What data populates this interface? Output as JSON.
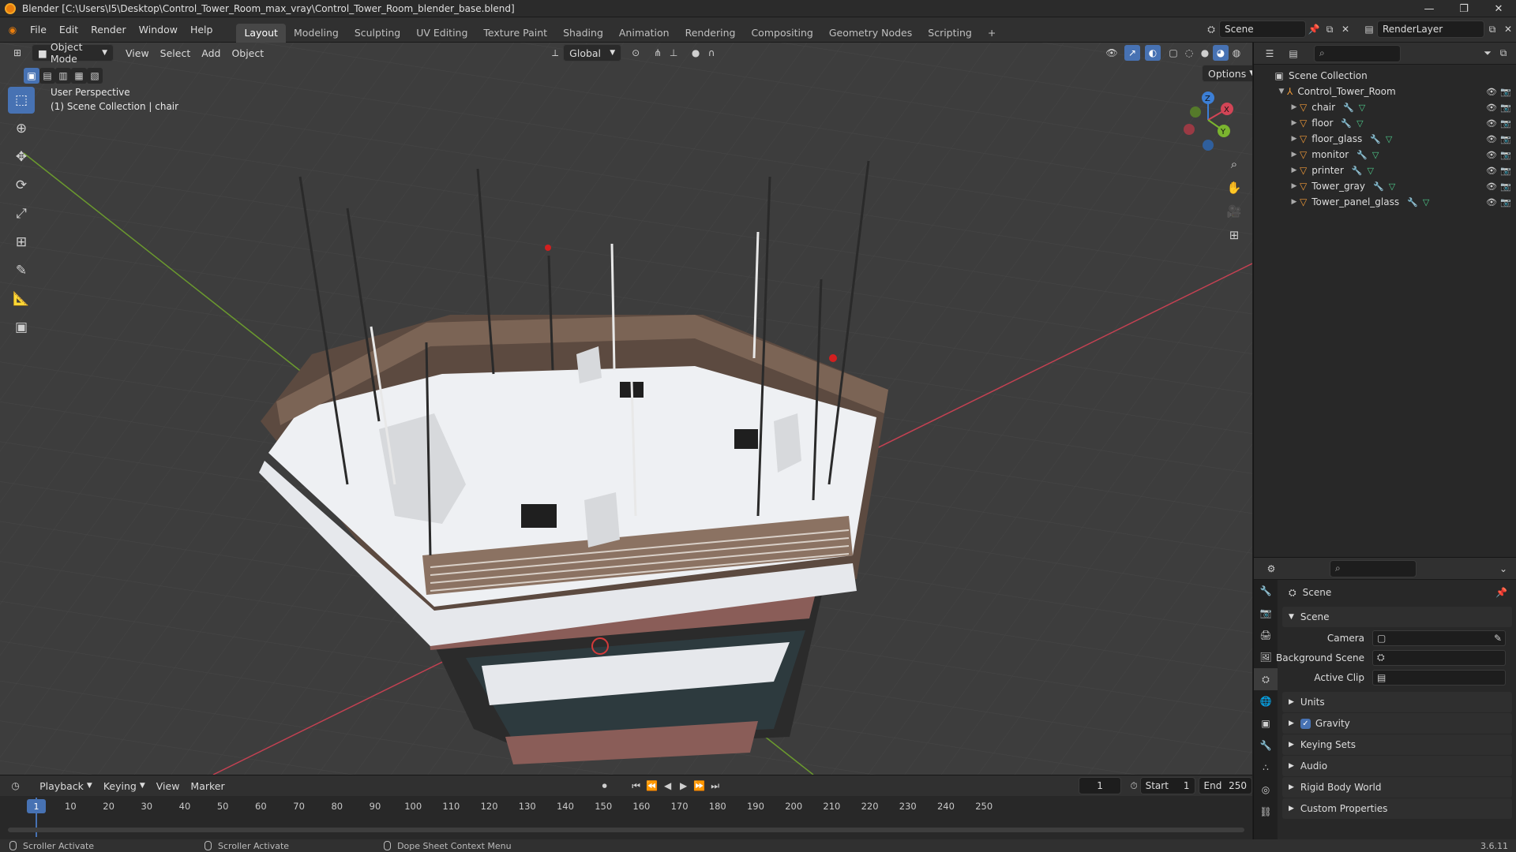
{
  "window": {
    "title": "Blender [C:\\Users\\I5\\Desktop\\Control_Tower_Room_max_vray\\Control_Tower_Room_blender_base.blend]",
    "min": "—",
    "max": "❐",
    "close": "✕"
  },
  "menu": [
    "File",
    "Edit",
    "Render",
    "Window",
    "Help"
  ],
  "workspaces": [
    {
      "label": "Layout",
      "active": true
    },
    {
      "label": "Modeling"
    },
    {
      "label": "Sculpting"
    },
    {
      "label": "UV Editing"
    },
    {
      "label": "Texture Paint"
    },
    {
      "label": "Shading"
    },
    {
      "label": "Animation"
    },
    {
      "label": "Rendering"
    },
    {
      "label": "Compositing"
    },
    {
      "label": "Geometry Nodes"
    },
    {
      "label": "Scripting"
    }
  ],
  "scene_field": "Scene",
  "renderlayer_field": "RenderLayer",
  "viewport": {
    "mode": "Object Mode",
    "menus": [
      "View",
      "Select",
      "Add",
      "Object"
    ],
    "transform_orientation": "Global",
    "options": "Options",
    "info_line1": "User Perspective",
    "info_line2": "(1) Scene Collection | chair",
    "gizmo": {
      "x": "X",
      "y": "Y",
      "z": "Z"
    },
    "colors": {
      "bg": "#3d3d3d",
      "grid": "#4a4a4a",
      "x_axis": "#c44152",
      "y_axis": "#6b9a2e"
    }
  },
  "outliner": {
    "root": "Scene Collection",
    "collection": "Control_Tower_Room",
    "objects": [
      "chair",
      "floor",
      "floor_glass",
      "monitor",
      "printer",
      "Tower_gray",
      "Tower_panel_glass"
    ]
  },
  "properties": {
    "title": "Scene",
    "section": "Scene",
    "rows": [
      {
        "label": "Camera",
        "value": ""
      },
      {
        "label": "Background Scene",
        "value": ""
      },
      {
        "label": "Active Clip",
        "value": ""
      }
    ],
    "collapsed": [
      "Units",
      "Gravity",
      "Keying Sets",
      "Audio",
      "Rigid Body World",
      "Custom Properties"
    ]
  },
  "timeline": {
    "menus": [
      "Playback",
      "Keying",
      "View",
      "Marker"
    ],
    "current_frame": "1",
    "start_label": "Start",
    "start": "1",
    "end_label": "End",
    "end": "250",
    "ticks": [
      "10",
      "20",
      "30",
      "40",
      "50",
      "60",
      "70",
      "80",
      "90",
      "100",
      "110",
      "120",
      "130",
      "140",
      "150",
      "160",
      "170",
      "180",
      "190",
      "200",
      "210",
      "220",
      "230",
      "240",
      "250"
    ]
  },
  "statusbar": {
    "items": [
      "Scroller Activate",
      "Scroller Activate",
      "Dope Sheet Context Menu"
    ],
    "version": "3.6.11"
  }
}
